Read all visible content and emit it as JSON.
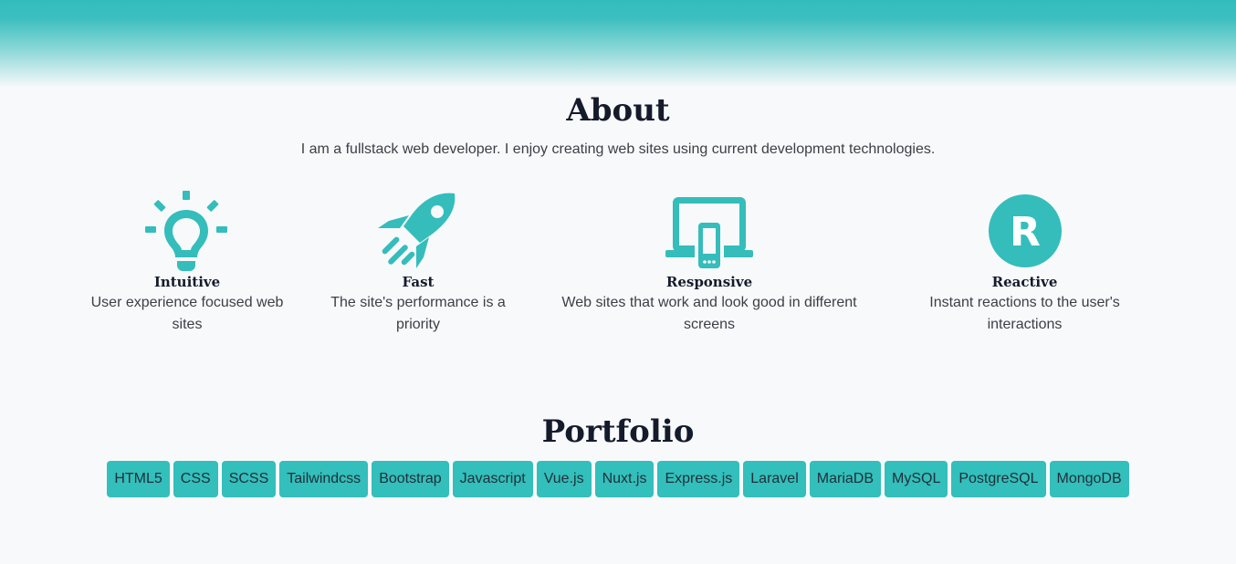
{
  "about": {
    "title": "About",
    "text": "I am a fullstack web developer. I enjoy creating web sites using current development technologies."
  },
  "features": [
    {
      "icon": "lightbulb-icon",
      "name": "Intuitive",
      "desc": "User experience focused web sites"
    },
    {
      "icon": "rocket-icon",
      "name": "Fast",
      "desc": "The site's performance is a priority"
    },
    {
      "icon": "devices-icon",
      "name": "Responsive",
      "desc": "Web sites that work and look good in different screens"
    },
    {
      "icon": "reactive-r-icon",
      "name": "Reactive",
      "desc": "Instant reactions to the user's interactions"
    }
  ],
  "reactive_icon_letter": "R",
  "portfolio": {
    "title": "Portfolio",
    "tags": [
      "HTML5",
      "CSS",
      "SCSS",
      "Tailwindcss",
      "Bootstrap",
      "Javascript",
      "Vue.js",
      "Nuxt.js",
      "Express.js",
      "Laravel",
      "MariaDB",
      "MySQL",
      "PostgreSQL",
      "MongoDB"
    ]
  },
  "colors": {
    "accent": "#34bdbb",
    "heading": "#141b2b",
    "text": "#3b3f46",
    "background": "#f8f9fb"
  }
}
